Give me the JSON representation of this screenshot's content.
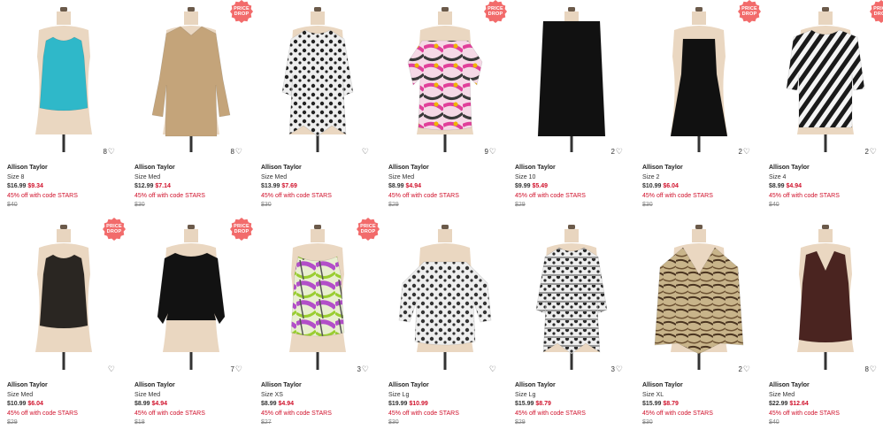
{
  "colors": {
    "sale_red": "#d0112b",
    "badge_red": "#f26b6b"
  },
  "badge_text": [
    "PRICE",
    "DROP"
  ],
  "products": [
    {
      "brand": "Allison Taylor",
      "size": "Size 8",
      "price": "$16.99",
      "sale": "$9.34",
      "promo": "45% off with code STARS",
      "orig": "$40",
      "favs": "8",
      "badge": false,
      "garment": "tank",
      "color": "#2fb8c9",
      "pattern": "none"
    },
    {
      "brand": "Allison Taylor",
      "size": "Size Med",
      "price": "$12.99",
      "sale": "$7.14",
      "promo": "45% off with code STARS",
      "orig": "$30",
      "favs": "8",
      "badge": true,
      "garment": "shirt",
      "color": "#c4a47a",
      "pattern": "none"
    },
    {
      "brand": "Allison Taylor",
      "size": "Size Med",
      "price": "$13.99",
      "sale": "$7.69",
      "promo": "45% off with code STARS",
      "orig": "$30",
      "favs": "",
      "badge": false,
      "garment": "tunic",
      "color": "#222222",
      "pattern": "dots"
    },
    {
      "brand": "Allison Taylor",
      "size": "Size Med",
      "price": "$8.99",
      "sale": "$4.94",
      "promo": "45% off with code STARS",
      "orig": "$29",
      "favs": "9",
      "badge": true,
      "garment": "blouse",
      "color": "#e86aa8",
      "pattern": "swirl"
    },
    {
      "brand": "Allison Taylor",
      "size": "Size 10",
      "price": "$9.99",
      "sale": "$5.49",
      "promo": "45% off with code STARS",
      "orig": "$29",
      "favs": "2",
      "badge": false,
      "garment": "skirt",
      "color": "#111111",
      "pattern": "none"
    },
    {
      "brand": "Allison Taylor",
      "size": "Size 2",
      "price": "$10.99",
      "sale": "$6.04",
      "promo": "45% off with code STARS",
      "orig": "$30",
      "favs": "2",
      "badge": true,
      "garment": "dress",
      "color": "#111111",
      "pattern": "none"
    },
    {
      "brand": "Allison Taylor",
      "size": "Size 4",
      "price": "$8.99",
      "sale": "$4.94",
      "promo": "45% off with code STARS",
      "orig": "$40",
      "favs": "2",
      "badge": true,
      "garment": "jacket",
      "color": "#222222",
      "pattern": "zebra"
    },
    {
      "brand": "Allison Taylor",
      "size": "Size Med",
      "price": "$10.99",
      "sale": "$6.04",
      "promo": "45% off with code STARS",
      "orig": "$29",
      "favs": "",
      "badge": true,
      "garment": "tank",
      "color": "#2a2622",
      "pattern": "none"
    },
    {
      "brand": "Allison Taylor",
      "size": "Size Med",
      "price": "$8.99",
      "sale": "$4.94",
      "promo": "45% off with code STARS",
      "orig": "$18",
      "favs": "7",
      "badge": true,
      "garment": "sweater",
      "color": "#121212",
      "pattern": "none"
    },
    {
      "brand": "Allison Taylor",
      "size": "Size XS",
      "price": "$8.99",
      "sale": "$4.94",
      "promo": "45% off with code STARS",
      "orig": "$27",
      "favs": "3",
      "badge": true,
      "garment": "sleeveless",
      "color": "#b57ad1",
      "pattern": "swirl2"
    },
    {
      "brand": "Allison Taylor",
      "size": "Size Lg",
      "price": "$19.99",
      "sale": "$10.99",
      "promo": "45% off with code STARS",
      "orig": "$30",
      "favs": "",
      "badge": false,
      "garment": "peasant",
      "color": "#333333",
      "pattern": "dots"
    },
    {
      "brand": "Allison Taylor",
      "size": "Size Lg",
      "price": "$15.99",
      "sale": "$8.79",
      "promo": "45% off with code STARS",
      "orig": "$29",
      "favs": "3",
      "badge": false,
      "garment": "tunic",
      "color": "#2a2a2a",
      "pattern": "dots2"
    },
    {
      "brand": "Allison Taylor",
      "size": "Size XL",
      "price": "$15.99",
      "sale": "$8.79",
      "promo": "45% off with code STARS",
      "orig": "$30",
      "favs": "2",
      "badge": false,
      "garment": "poncho",
      "color": "#8a7250",
      "pattern": "animal"
    },
    {
      "brand": "Allison Taylor",
      "size": "Size Med",
      "price": "$22.99",
      "sale": "$12.64",
      "promo": "45% off with code STARS",
      "orig": "$40",
      "favs": "8",
      "badge": false,
      "garment": "vneck",
      "color": "#4a2420",
      "pattern": "none"
    }
  ]
}
